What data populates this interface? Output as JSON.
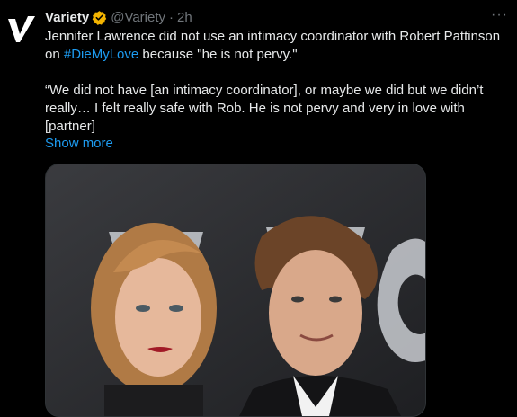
{
  "account": {
    "name": "Variety",
    "handle": "@Variety",
    "separator": "·",
    "time": "2h",
    "verified_icon": "gold-verified-badge-icon",
    "avatar_icon": "variety-v-logo"
  },
  "tweet": {
    "text_part1": "Jennifer Lawrence did not use an intimacy coordinator with Robert Pattinson on ",
    "hashtag": "#DieMyLove",
    "text_part2": " because \"he is not pervy.\"",
    "quote": "“We did not have [an intimacy coordinator], or maybe we did but we didn’t really… I felt really safe with Rob. He is not pervy and very in love with [partner]",
    "show_more": "Show more",
    "more_icon": "···"
  },
  "colors": {
    "background": "#000000",
    "text": "#e7e9ea",
    "muted": "#71767b",
    "link": "#1d9bf0",
    "verified": "#f4b400"
  }
}
